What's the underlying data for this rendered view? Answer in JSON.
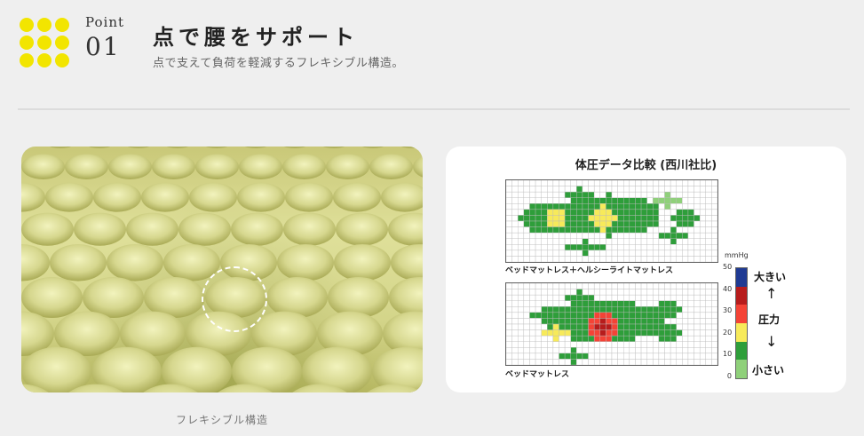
{
  "header": {
    "point_label": "Point",
    "point_number": "01",
    "title": "点で腰をサポート",
    "subtitle": "点で支えて負荷を軽減するフレキシブル構造。"
  },
  "foam": {
    "caption": "フレキシブル構造"
  },
  "pressure_chart": {
    "title": "体圧データ比較 (西川社比)",
    "map1_label": "ベッドマットレス＋ヘルシーライトマットレス",
    "map2_label": "ベッドマットレス",
    "unit": "mmHg",
    "ticks": [
      "50",
      "40",
      "30",
      "20",
      "10",
      "0"
    ],
    "legend_high": "大きい",
    "legend_mid": "圧力",
    "legend_low": "小さい",
    "arrow_up": "↑",
    "arrow_down": "↓",
    "scale_colors": [
      "#1f3a93",
      "#b71c1c",
      "#f44336",
      "#f7ea5a",
      "#2e9e3a",
      "#8fd07a",
      "#ffffff"
    ]
  },
  "colors": {
    "accent_yellow": "#f2e500",
    "background": "#efefef",
    "divider": "#dcdcdc"
  }
}
